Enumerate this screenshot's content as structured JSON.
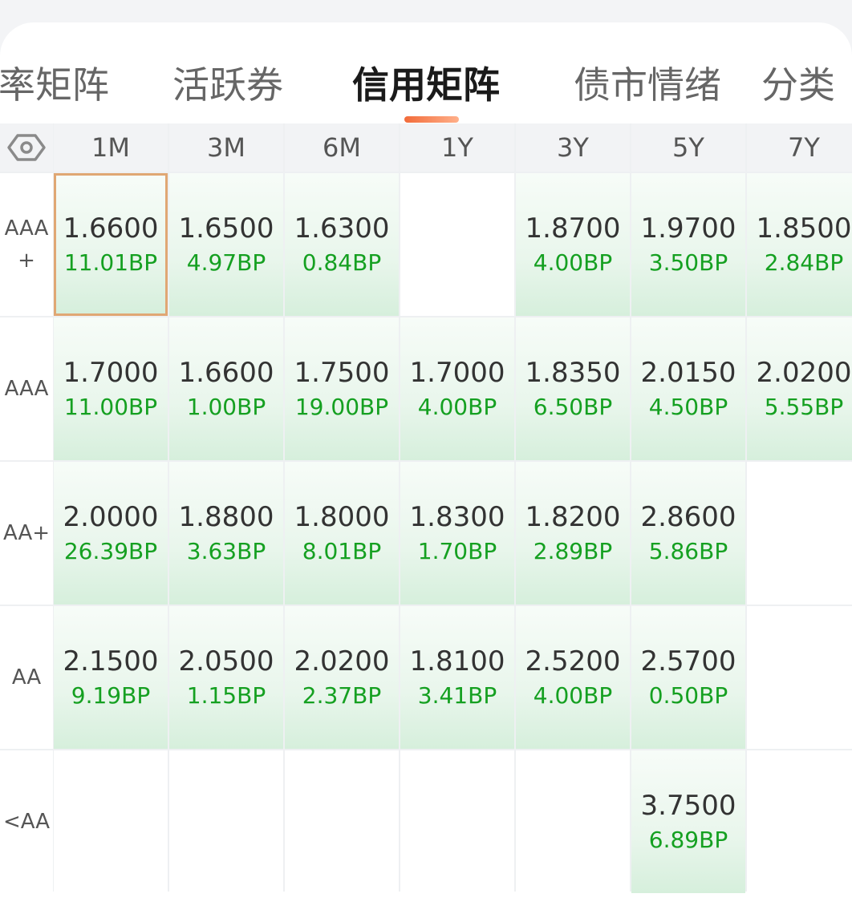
{
  "tabs": [
    {
      "label": "率矩阵",
      "active": false
    },
    {
      "label": "活跃券",
      "active": false
    },
    {
      "label": "信用矩阵",
      "active": true
    },
    {
      "label": "债市情绪",
      "active": false
    },
    {
      "label": "分类",
      "active": false
    }
  ],
  "columns": [
    "1M",
    "3M",
    "6M",
    "1Y",
    "3Y",
    "5Y",
    "7Y"
  ],
  "rows": [
    {
      "label_line1": "AAA",
      "label_line2": "+",
      "cells": [
        {
          "value": "1.6600",
          "change": "11.01BP",
          "selected": true
        },
        {
          "value": "1.6500",
          "change": "4.97BP"
        },
        {
          "value": "1.6300",
          "change": "0.84BP"
        },
        null,
        {
          "value": "1.8700",
          "change": "4.00BP"
        },
        {
          "value": "1.9700",
          "change": "3.50BP"
        },
        {
          "value": "1.8500",
          "change": "2.84BP"
        }
      ]
    },
    {
      "label_line1": "AAA",
      "label_line2": "",
      "cells": [
        {
          "value": "1.7000",
          "change": "11.00BP"
        },
        {
          "value": "1.6600",
          "change": "1.00BP"
        },
        {
          "value": "1.7500",
          "change": "19.00BP"
        },
        {
          "value": "1.7000",
          "change": "4.00BP"
        },
        {
          "value": "1.8350",
          "change": "6.50BP"
        },
        {
          "value": "2.0150",
          "change": "4.50BP"
        },
        {
          "value": "2.0200",
          "change": "5.55BP"
        }
      ]
    },
    {
      "label_line1": "AA+",
      "label_line2": "",
      "cells": [
        {
          "value": "2.0000",
          "change": "26.39BP"
        },
        {
          "value": "1.8800",
          "change": "3.63BP"
        },
        {
          "value": "1.8000",
          "change": "8.01BP"
        },
        {
          "value": "1.8300",
          "change": "1.70BP"
        },
        {
          "value": "1.8200",
          "change": "2.89BP"
        },
        {
          "value": "2.8600",
          "change": "5.86BP"
        },
        null
      ]
    },
    {
      "label_line1": "AA",
      "label_line2": "",
      "cells": [
        {
          "value": "2.1500",
          "change": "9.19BP"
        },
        {
          "value": "2.0500",
          "change": "1.15BP"
        },
        {
          "value": "2.0200",
          "change": "2.37BP"
        },
        {
          "value": "1.8100",
          "change": "3.41BP"
        },
        {
          "value": "2.5200",
          "change": "4.00BP"
        },
        {
          "value": "2.5700",
          "change": "0.50BP"
        },
        null
      ]
    },
    {
      "label_line1": "<AA",
      "label_line2": "",
      "cells": [
        null,
        null,
        null,
        null,
        null,
        {
          "value": "3.7500",
          "change": "6.89BP"
        },
        null
      ]
    }
  ],
  "icons": {
    "settings": "hexagon-settings-icon"
  },
  "colors": {
    "accent": "#f26b3a",
    "change_green": "#15a021",
    "selected_border": "#e0a774"
  }
}
